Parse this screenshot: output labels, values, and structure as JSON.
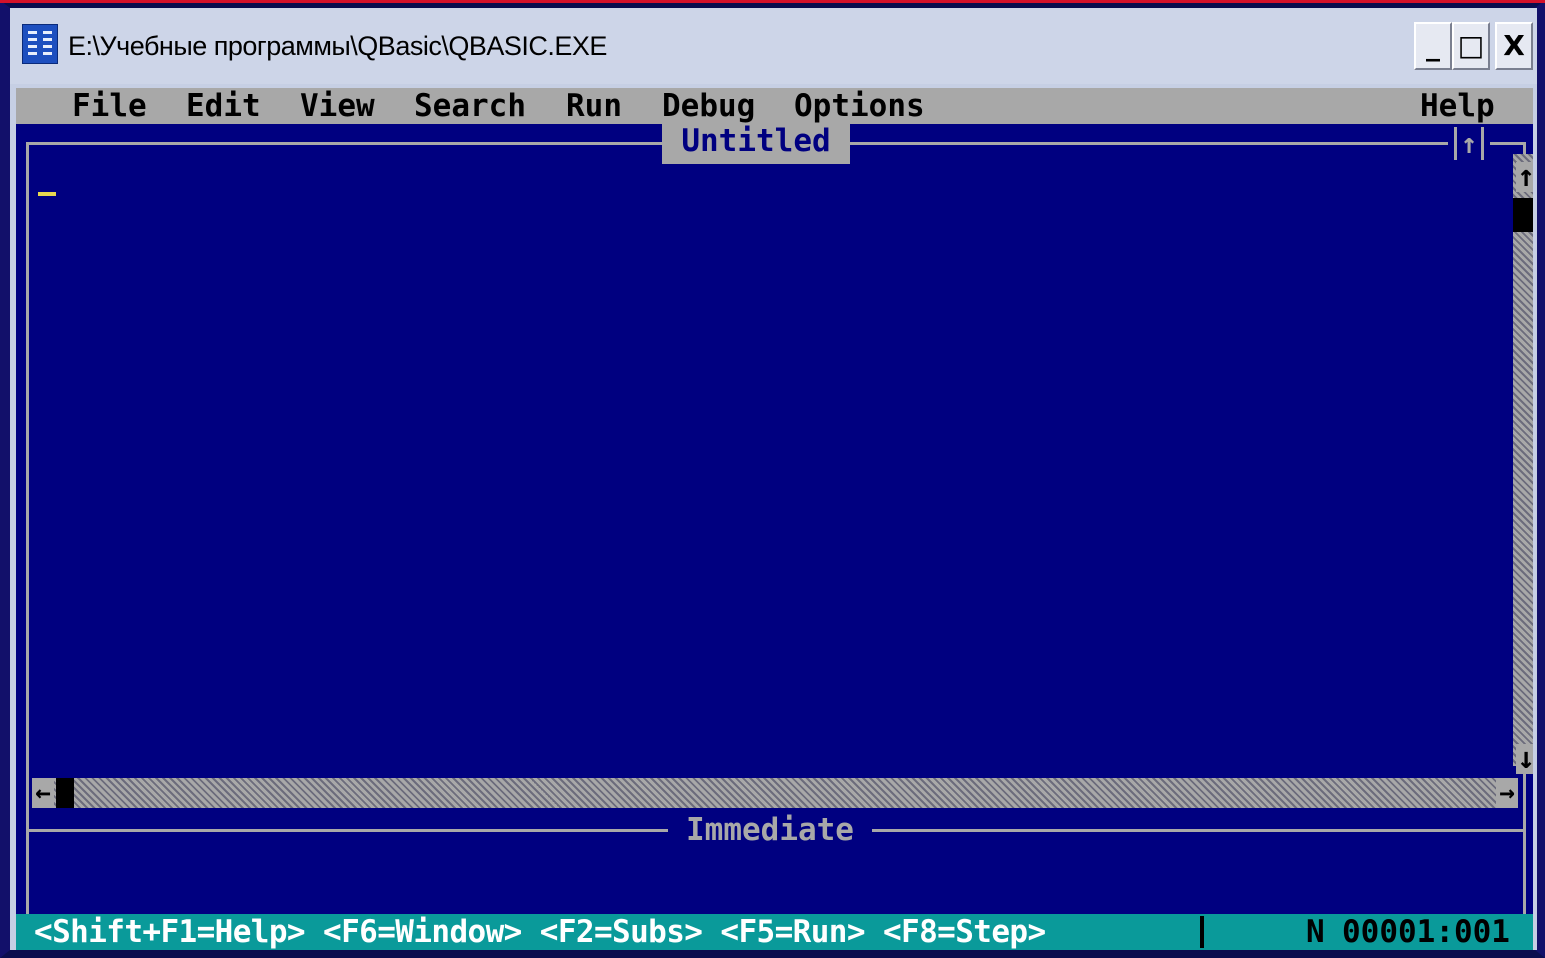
{
  "window": {
    "title": "E:\\Учебные программы\\QBasic\\QBASIC.EXE",
    "minimize_label": "_",
    "maximize_label": "□",
    "close_label": "X"
  },
  "menu": {
    "items": [
      "File",
      "Edit",
      "View",
      "Search",
      "Run",
      "Debug",
      "Options"
    ],
    "help": "Help"
  },
  "editor": {
    "title": "Untitled",
    "maximize_glyph": "↑"
  },
  "scroll": {
    "up": "↑",
    "down": "↓",
    "left": "←",
    "right": "→"
  },
  "immediate": {
    "title": "Immediate"
  },
  "status": {
    "hints": "<Shift+F1=Help> <F6=Window> <F2=Subs> <F5=Run> <F8=Step>",
    "mode": "N",
    "position": "00001:001"
  },
  "colors": {
    "screen_bg": "#000080",
    "menu_bg": "#a8a8a8",
    "status_bg": "#0a9a9a",
    "cursor": "#e8d850"
  }
}
